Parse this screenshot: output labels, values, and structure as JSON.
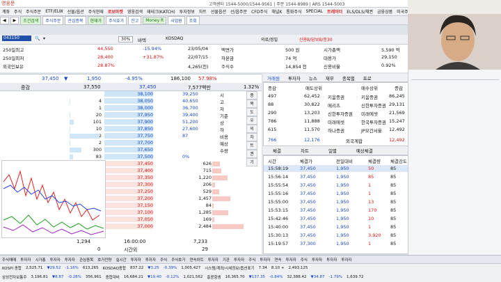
{
  "app": {
    "title": "영웅문",
    "info": "고객센터 1544-5000/1544-9561 | 주문 1544-8989 | ARS 1544-5003"
  },
  "menu": [
    "계좌",
    "주식",
    "주식주문",
    "ETF/ELW",
    "선물/옵션",
    "주식현재",
    "로보마켓",
    "영웅검색",
    "재테크(KATCH)",
    "투자정보",
    "차트",
    "선물옵션",
    "선/옵주문",
    "CFD주식",
    "채널K",
    "통화주식",
    "SPECIAL",
    "트레이더",
    "ELS/DLS/채권",
    "금융상품",
    "미국주식"
  ],
  "menu_highlight": [
    "로보마켓",
    "트레이더"
  ],
  "toolbar": [
    "조건검색",
    "주식주문",
    "관심종목",
    "현재가",
    "주식호가",
    "잔고",
    "Money R",
    "사업원",
    "조회"
  ],
  "stock": {
    "code": "043150",
    "market": "KOSDAQ",
    "name": "바텍",
    "sector": "의료/정밀",
    "badges": "신용B/담보B/증30",
    "pct": "30%",
    "price": "37,450",
    "change_arrow": "▼",
    "change": "1,950",
    "change_pct": "-4.95%",
    "volume": "186,100",
    "volume_ratio": "57.98%"
  },
  "info_rows": [
    {
      "k": "250일최고",
      "v": "44,550",
      "p": "-15.94%",
      "d": "23/05/04",
      "k2": "액면가",
      "v2": "500 원",
      "k3": "시가총액",
      "v3": "5,590 억",
      "k4": "PBR"
    },
    {
      "k": "250일최저",
      "v": "28,400",
      "p": "+31.87%",
      "d": "22/07/15",
      "k2": "자본금",
      "v2": "74 억",
      "k3": "대용가",
      "v3": "29,150",
      "k4": "PER"
    },
    {
      "k": "외국인보유",
      "v": "28.87%",
      "p": "",
      "d": "4,265(천)",
      "k2": "주식수",
      "v2": "14,854 천",
      "k3": "신용비율",
      "v3": "0.92%",
      "k4": "결산월"
    }
  ],
  "price_header": {
    "price": "37,450",
    "arrow": "▼",
    "change": "1,950",
    "pct": "-4.95%",
    "volume": "186,100",
    "ratio": "57.98%",
    "rate": "1.32%"
  },
  "hoga": {
    "header": {
      "left": "증감",
      "ask_qty": "37,550",
      "ask_price": "37,450",
      "bid_qty": "7,577백만",
      "right": "1.32%"
    },
    "asks": [
      {
        "q": "",
        "p": "38,100",
        "l": "39,250",
        "lt": "시"
      },
      {
        "q": "4",
        "p": "38,050",
        "l": "40,650",
        "lt": "고"
      },
      {
        "q": "1",
        "p": "38,000",
        "l": "36,700",
        "lt": "저"
      },
      {
        "q": "20",
        "p": "37,950",
        "l": "39,400",
        "lt": "기준"
      },
      {
        "q": "101",
        "p": "37,900",
        "l": "51,200",
        "lt": "상"
      },
      {
        "q": "10",
        "p": "37,850",
        "l": "27,600",
        "lt": "하"
      },
      {
        "q": "772",
        "p": "37,750",
        "l": "87",
        "lt": "비용"
      },
      {
        "q": "2",
        "p": "37,700",
        "l": "",
        "lt": "예상"
      },
      {
        "q": "300",
        "p": "37,650",
        "l": "",
        "lt": "수량"
      },
      {
        "q": "83",
        "p": "37,500",
        "l": "0%",
        "lt": ""
      }
    ],
    "bids": [
      {
        "p": "37,450",
        "q": "626"
      },
      {
        "p": "37,400",
        "q": "715"
      },
      {
        "p": "37,350",
        "q": "1,220"
      },
      {
        "p": "37,300",
        "q": "206"
      },
      {
        "p": "37,250",
        "q": "529"
      },
      {
        "p": "37,200",
        "q": "1,457"
      },
      {
        "p": "37,150",
        "q": "84"
      },
      {
        "p": "37,100",
        "q": "1,285"
      },
      {
        "p": "37,050",
        "q": "169"
      },
      {
        "p": "37,000",
        "q": "2,484"
      }
    ],
    "side_buttons": [
      "종",
      "목",
      "도",
      "우",
      "의",
      "차",
      "트",
      "권",
      "기"
    ],
    "footer": {
      "left": "1,294",
      "time": "16:00:00",
      "right": "7,233",
      "sub": "시간외",
      "sub_left": "0",
      "sub_right": "29"
    }
  },
  "tabs": [
    "거래원",
    "투자자",
    "뉴스",
    "재무",
    "종목별",
    "프로"
  ],
  "trade": {
    "head": [
      "증감",
      "매도상위",
      "매수상위",
      "증감"
    ],
    "rows": [
      {
        "d": "497",
        "sq": "62,452",
        "s": "키움증권",
        "b": "키움증권",
        "bq": "86,245"
      },
      {
        "d": "88",
        "sq": "30,822",
        "s": "메리츠",
        "b": "신한투자증권",
        "bq": "29,131"
      },
      {
        "d": "290",
        "sq": "13,203",
        "s": "신한투자증권",
        "b": "미래에셋",
        "bq": "21,569"
      },
      {
        "d": "786",
        "sq": "11,888",
        "s": "미래에셋",
        "b": "한국투자증권",
        "bq": "15,247"
      },
      {
        "d": "615",
        "sq": "11,570",
        "s": "하나증권",
        "b": "JP모간서울",
        "bq": "12,492"
      }
    ],
    "foot": {
      "d": "766",
      "sq": "12,176",
      "label": "외국계합",
      "bq": "12,492"
    }
  },
  "subtabs": [
    "체결",
    "차트",
    "일별",
    "예상체결"
  ],
  "ticks_head": [
    "시간",
    "체결가",
    "전일대비",
    "체결량",
    "체결강도"
  ],
  "ticks": [
    {
      "t": "15:58:19",
      "p": "37,450",
      "c": "1,950",
      "q": "50",
      "s": "85"
    },
    {
      "t": "15:56:14",
      "p": "37,450",
      "c": "1,950",
      "q": "85",
      "s": "85"
    },
    {
      "t": "15:55:54",
      "p": "37,450",
      "c": "1,950",
      "q": "1",
      "s": "85"
    },
    {
      "t": "15:55:16",
      "p": "37,450",
      "c": "1,950",
      "q": "1",
      "s": "85"
    },
    {
      "t": "15:55:00",
      "p": "37,450",
      "c": "1,950",
      "q": "13",
      "s": "85"
    },
    {
      "t": "15:53:15",
      "p": "37,450",
      "c": "1,950",
      "q": "170",
      "s": "85"
    },
    {
      "t": "15:42:46",
      "p": "37,450",
      "c": "1,950",
      "q": "10",
      "s": "85"
    },
    {
      "t": "15:40:00",
      "p": "37,450",
      "c": "1,950",
      "q": "1",
      "s": "85"
    },
    {
      "t": "15:30:13",
      "p": "37,450",
      "c": "1,950",
      "q": "3,920",
      "s": "85"
    },
    {
      "t": "15:19:57",
      "p": "37,300",
      "c": "1,950",
      "q": "1",
      "s": "85"
    }
  ],
  "taskbar": [
    "주식매매",
    "투자자",
    "시가총",
    "투자자",
    "투자자",
    "관심종목",
    "호가잔량",
    "실시간",
    "투자자",
    "투자자",
    "주식",
    "주식호가",
    "연속차트",
    "투자자",
    "기관",
    "투자자",
    "주식",
    "투자자",
    "연속",
    "투자자",
    "주식",
    "투자자",
    "투자자",
    "투자자"
  ],
  "status": {
    "line1": [
      "KOSPI 종합",
      "2,525.71",
      "▼29.52",
      "-1.16%",
      "613,265",
      "KOSDAQ종합",
      "837.22",
      "▼3.25",
      "-0.39%",
      "1,005,427",
      "시스템/계좌/시세정보/옵션표기",
      "7.34",
      "8.10 +",
      "2,493,125"
    ],
    "line2": [
      "삼성전자보통주",
      "3,196.81",
      "▼8.87",
      "-0.28%",
      "356,961",
      "종합대비",
      "16,684.21",
      "▼19.40",
      "-0.12%",
      "1,021,562",
      "홍콩항셍",
      "16,365.70",
      "▼137.35",
      "-0.84%",
      "32,388.42",
      "▼34.87",
      "-1.79%",
      "1,639.72"
    ]
  },
  "colors": {
    "ask": "#cfe5f8",
    "bid": "#fbe4e0",
    "down": "#1646d1",
    "up": "#d11111"
  }
}
